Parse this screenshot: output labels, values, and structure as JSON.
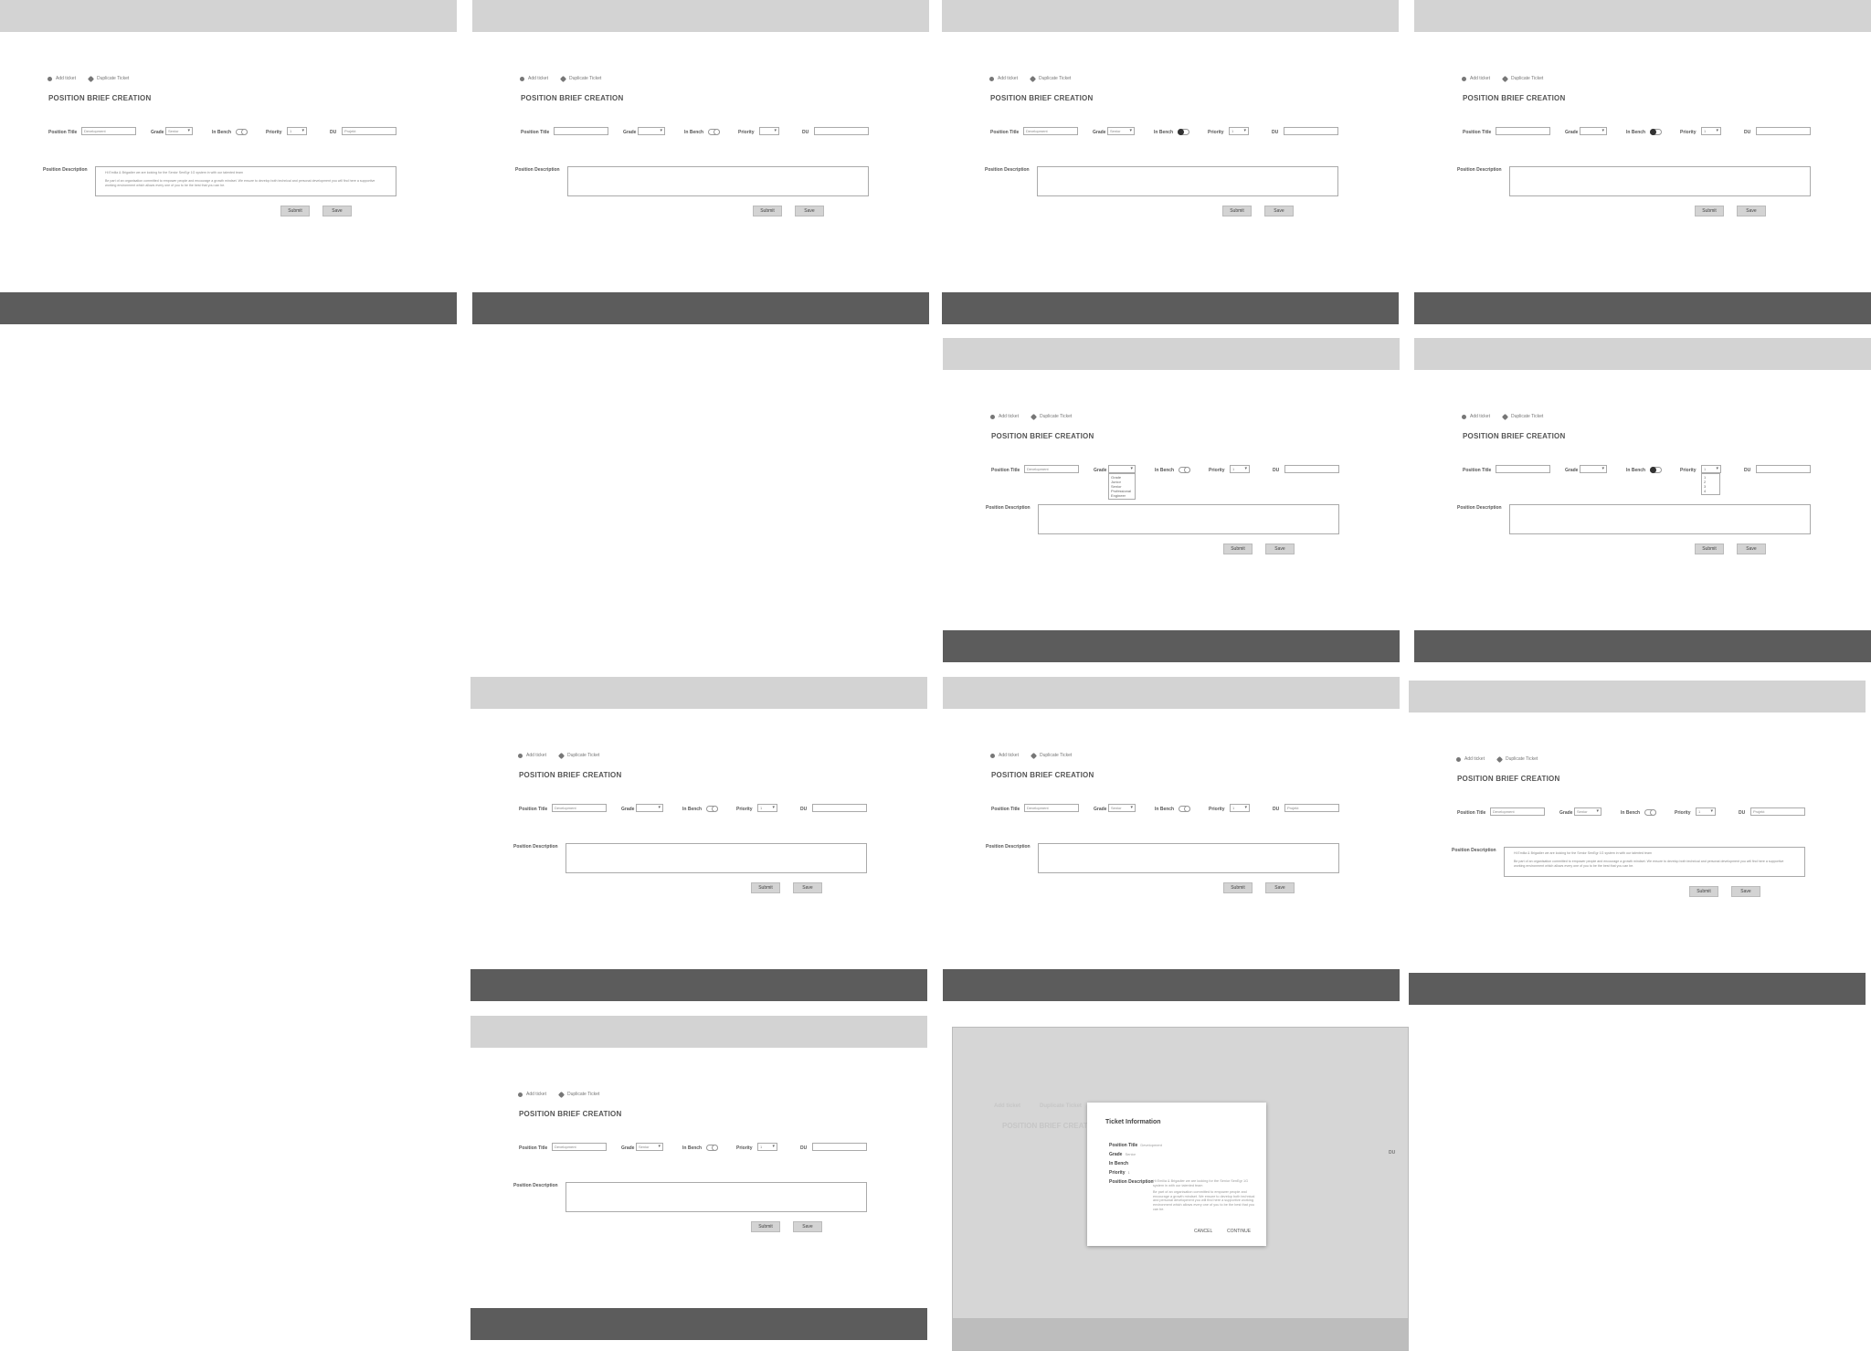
{
  "common": {
    "add_ticket": "Add ticket",
    "duplicate_ticket": "Duplicate Ticket",
    "title": "POSITION BRIEF CREATION",
    "position_title_label": "Position Title",
    "grade_label": "Grade",
    "in_bench_label": "In Bench",
    "priority_label": "Priority",
    "du_label": "DU",
    "description_label": "Position Description",
    "submit_label": "Submit",
    "save_label": "Save"
  },
  "frames": [
    {
      "position_title": "Development",
      "grade": "Senior",
      "in_bench": false,
      "priority": "1",
      "du": "Projekt",
      "description": [
        "Hi Emilia & Brigadier we are looking for the Senior SenEgr 1G system in with our talented team",
        "Be part of an organisation committed to empower people and encourage a growth mindset. We ensure to develop both technical and personal development you will find here a supportive working environment which allows every one of you to be the best that you can be."
      ]
    },
    {
      "position_title": "",
      "grade": "",
      "in_bench": false,
      "priority": "",
      "du": "",
      "description": []
    },
    {
      "position_title": "Development",
      "grade": "Senior",
      "in_bench": true,
      "priority": "1",
      "du": "",
      "description": []
    },
    {
      "position_title": "",
      "grade": "",
      "in_bench": true,
      "priority": "1",
      "du": "",
      "description": []
    },
    {
      "position_title": "Development",
      "grade": "",
      "in_bench": false,
      "priority": "1",
      "du": "",
      "description": [],
      "grade_options": [
        "Grade",
        "Junior",
        "Senior",
        "Professional",
        "Engineer"
      ]
    },
    {
      "position_title": "",
      "grade": "",
      "in_bench": true,
      "priority": "1",
      "du": "",
      "description": [],
      "priority_options": [
        "1",
        "2",
        "3",
        "4"
      ]
    },
    {
      "position_title": "Development",
      "grade": "",
      "in_bench": false,
      "priority": "1",
      "du": "",
      "description": []
    },
    {
      "position_title": "Development",
      "grade": "Senior",
      "in_bench": false,
      "priority": "1",
      "du": "Projekt",
      "description": []
    },
    {
      "position_title": "Development",
      "grade": "Senior",
      "in_bench": false,
      "priority": "1",
      "du": "Projekt",
      "description": [
        "Hi Emilia & Brigadier we are looking for the Senior SenEgr 1G system in with our talented team",
        "Be part of an organisation committed to empower people and encourage a growth mindset. We ensure to develop both technical and personal development you will find here a supportive working environment which allows every one of you to be the best that you can be."
      ]
    },
    {
      "position_title": "Development",
      "grade": "Senior",
      "in_bench": false,
      "priority": "1",
      "du": "",
      "description": []
    }
  ],
  "dialog": {
    "title": "Ticket Information",
    "position_title_label": "Position Title",
    "position_title_value": "Development",
    "grade_label": "Grade",
    "grade_value": "Senior",
    "in_bench_label": "In Bench",
    "priority_label": "Priority",
    "priority_value": "1",
    "description_label": "Position Description",
    "description_p1": "Hi Emilia & Brigadier we are looking for the Senior SenEgr 1G system in with our talented team",
    "description_p2": "Be part of an organisation committed to empower people and encourage a growth mindset. We ensure to develop both technical and personal development you will find here a supportive working environment which allows every one of you to be the best that you can be.",
    "cancel_label": "CANCEL",
    "continue_label": "CONTINUE",
    "du_label": "DU"
  }
}
